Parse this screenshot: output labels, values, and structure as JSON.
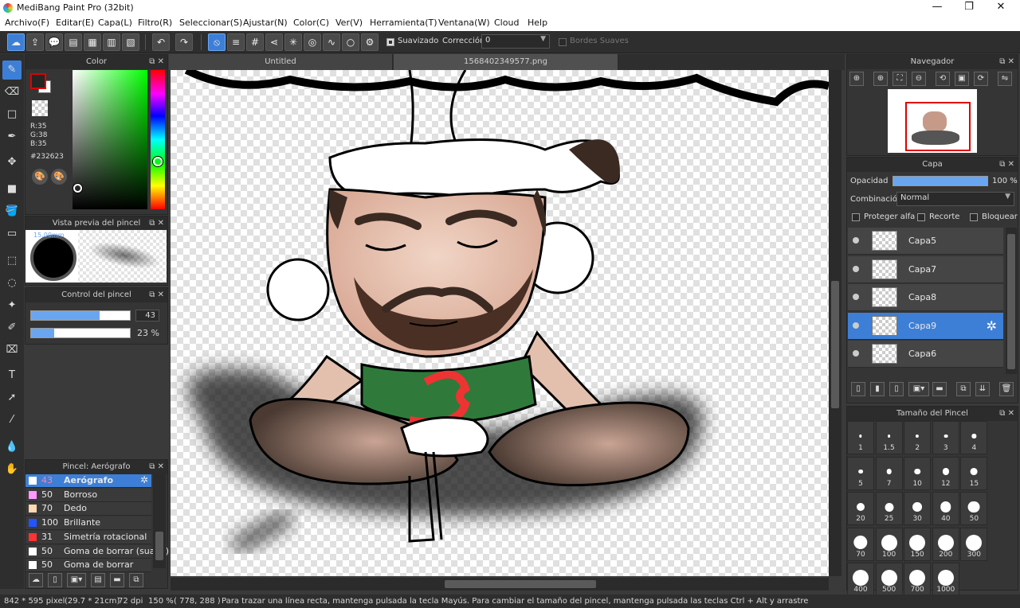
{
  "window": {
    "title": "MediBang Paint Pro (32bit)",
    "minimize": "—",
    "maximize": "❐",
    "close": "✕"
  },
  "menu": [
    "Archivo(F)",
    "Editar(E)",
    "Capa(L)",
    "Filtro(R)",
    "Seleccionar(S)",
    "Ajustar(N)",
    "Color(C)",
    "Ver(V)",
    "Herramienta(T)",
    "Ventana(W)",
    "Cloud",
    "Help"
  ],
  "toolbar": {
    "smoothing_label": "Suavizado",
    "correction_label": "Corrección",
    "correction_value": "0",
    "soft_edges_label": "Bordes Suaves"
  },
  "color_panel": {
    "title": "Color",
    "rgb_r": "R:35",
    "rgb_g": "G:38",
    "rgb_b": "B:35",
    "hex": "#232623",
    "primary": "#232623",
    "fg_swatch_border": "#e00000"
  },
  "brush_preview": {
    "title": "Vista previa del pincel",
    "size_label": "15.00mm"
  },
  "brush_control": {
    "title": "Control del pincel",
    "size_value": "43",
    "size_fraction": 0.69,
    "opacity_value": "23 %",
    "opacity_fraction": 0.23
  },
  "brush_list": {
    "title": "Pincel: Aerógrafo",
    "items": [
      {
        "size": "43",
        "name": "Aerógrafo",
        "color": "#ffffff"
      },
      {
        "size": "50",
        "name": "Borroso",
        "color": "#ff99ff"
      },
      {
        "size": "70",
        "name": "Dedo",
        "color": "#ffd9b3"
      },
      {
        "size": "100",
        "name": "Brillante",
        "color": "#2255ff"
      },
      {
        "size": "31",
        "name": "Simetría rotacional",
        "color": "#ff3333"
      },
      {
        "size": "50",
        "name": "Goma de borrar (suave)",
        "color": "#ffffff"
      },
      {
        "size": "50",
        "name": "Goma de borrar",
        "color": "#ffffff"
      }
    ]
  },
  "tabs": [
    {
      "label": "Untitled"
    },
    {
      "label": "1568402349577.png"
    }
  ],
  "navigator": {
    "title": "Navegador"
  },
  "layers": {
    "title": "Capa",
    "opacity_label": "Opacidad",
    "opacity_value": "100 %",
    "opacity_fraction": 1.0,
    "blend_label": "Combinación",
    "blend_value": "Normal",
    "protect_alpha": "Proteger alfa",
    "clipping": "Recorte",
    "lock": "Bloquear",
    "items": [
      {
        "name": "Capa5"
      },
      {
        "name": "Capa7"
      },
      {
        "name": "Capa8"
      },
      {
        "name": "Capa9"
      },
      {
        "name": "Capa6"
      }
    ]
  },
  "brush_sizes": {
    "title": "Tamaño del Pincel",
    "items": [
      "1",
      "1.5",
      "2",
      "3",
      "4",
      "5",
      "7",
      "10",
      "12",
      "15",
      "20",
      "25",
      "30",
      "40",
      "50",
      "70",
      "100",
      "150",
      "200",
      "300",
      "400",
      "500",
      "700",
      "1000"
    ]
  },
  "status": {
    "size": "842 * 595 pixel",
    "physical": "(29.7 * 21cm)",
    "dpi": "72 dpi",
    "zoom": "150 %",
    "coords": "( 778, 288 )",
    "hint": "Para trazar una línea recta, mantenga pulsada la tecla Mayús. Para cambiar el tamaño del pincel, mantenga pulsada las teclas Ctrl + Alt y arrastre"
  }
}
